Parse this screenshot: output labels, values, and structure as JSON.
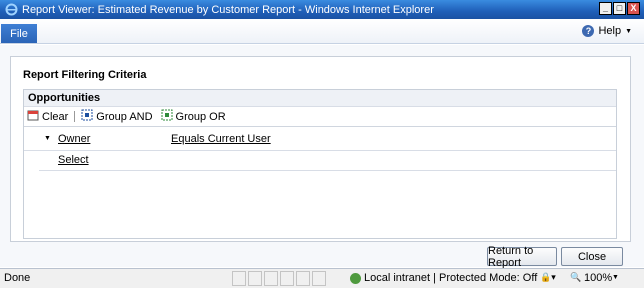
{
  "window": {
    "title": "Report Viewer: Estimated Revenue by Customer Report - Windows Internet Explorer",
    "minimize": "_",
    "maximize": "□",
    "close": "X"
  },
  "menu": {
    "file": "File",
    "help": "Help"
  },
  "panel": {
    "title": "Report Filtering Criteria",
    "entity": "Opportunities",
    "toolbar": {
      "clear": "Clear",
      "group_and": "Group AND",
      "group_or": "Group OR"
    },
    "filters": [
      {
        "field": "Owner",
        "operator": "Equals Current User"
      }
    ],
    "select": "Select"
  },
  "buttons": {
    "return": "Return to Report",
    "close": "Close"
  },
  "status": {
    "left": "Done",
    "zone": "Local intranet | Protected Mode: Off",
    "zoom": "100%"
  },
  "colors": {
    "titlebar": "#1f5fb8",
    "file_tab": "#2a64b7",
    "border": "#c8cfd9"
  }
}
